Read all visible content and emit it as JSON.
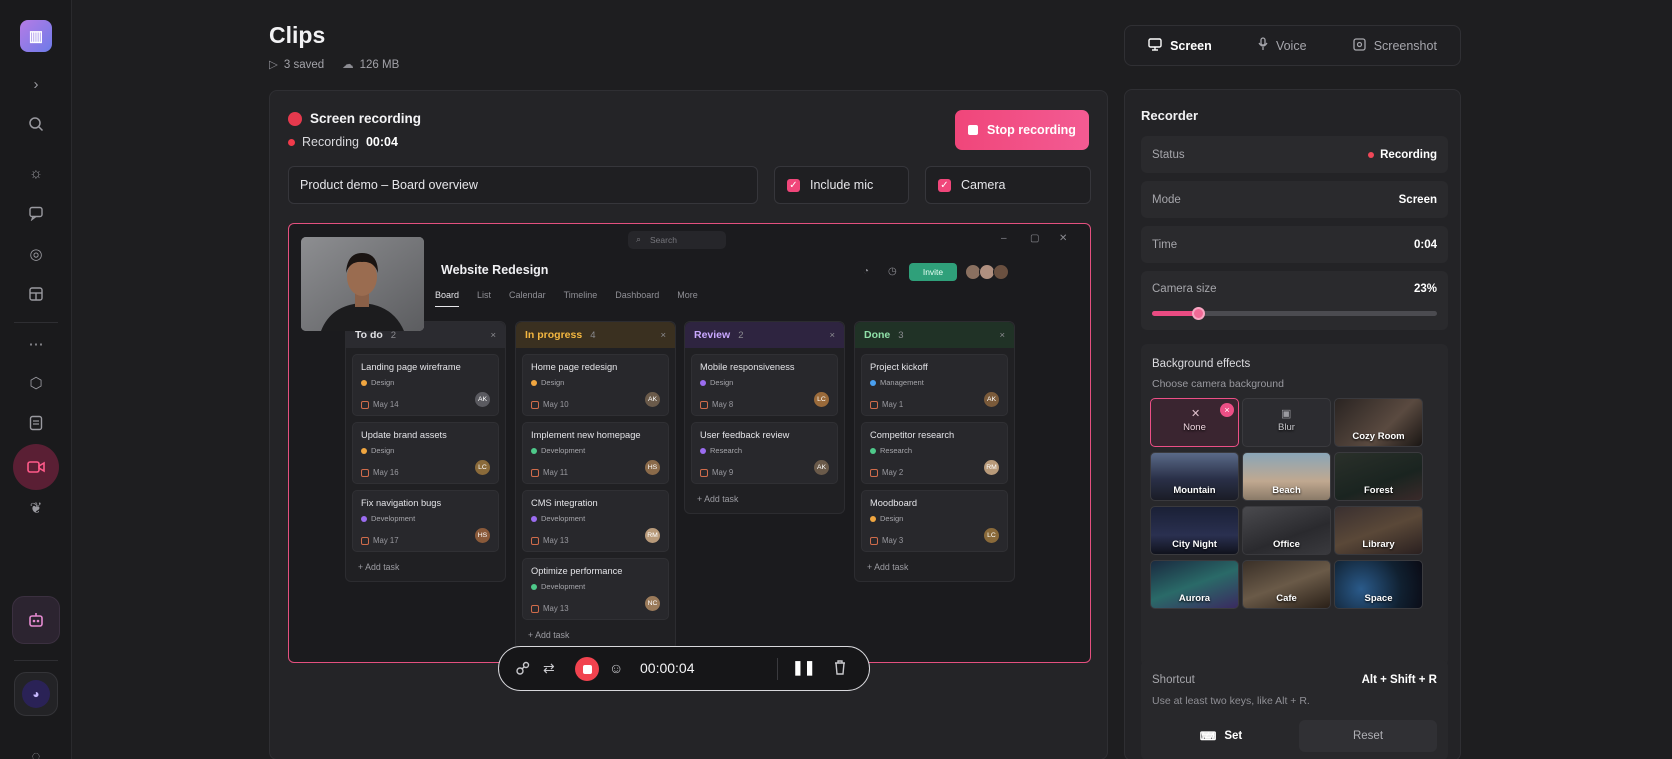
{
  "page": {
    "title": "Clips",
    "saved": "3 saved",
    "size": "126 MB"
  },
  "mode_tabs": [
    {
      "label": "Screen",
      "icon": "monitor-icon",
      "active": true
    },
    {
      "label": "Voice",
      "icon": "mic-icon",
      "active": false
    },
    {
      "label": "Screenshot",
      "icon": "screenshot-icon",
      "active": false
    }
  ],
  "recording": {
    "title": "Screen recording",
    "status_label": "Recording",
    "elapsed": "00:04",
    "stop_label": "Stop recording",
    "clip_name": "Product demo – Board overview",
    "include_mic_label": "Include mic",
    "include_mic_checked": true,
    "camera_label": "Camera",
    "camera_checked": true
  },
  "preview": {
    "search_placeholder": "Search",
    "project_title": "Website Redesign",
    "invite_label": "Invite",
    "tabs": [
      "Board",
      "List",
      "Calendar",
      "Timeline",
      "Dashboard",
      "More"
    ],
    "columns": [
      {
        "name": "To do",
        "count": "2",
        "color": "#2b2b30",
        "text_color": "#e0e0e4",
        "cards": [
          {
            "title": "Landing page wireframe",
            "tag": "Design",
            "tag_color": "#f0a640",
            "date": "May 14",
            "initials": "AK",
            "avatar": "#5a5a60"
          },
          {
            "title": "Update brand assets",
            "tag": "Design",
            "tag_color": "#f0a640",
            "date": "May 16",
            "initials": "LC",
            "avatar": "#8a6a3a"
          },
          {
            "title": "Fix navigation bugs",
            "tag": "Development",
            "tag_color": "#9b6cf0",
            "date": "May 17",
            "initials": "HS",
            "avatar": "#8a5a3a"
          }
        ],
        "add": "Add task"
      },
      {
        "name": "In progress",
        "count": "4",
        "color": "#3a3020",
        "text_color": "#f4b740",
        "cards": [
          {
            "title": "Home page redesign",
            "tag": "Design",
            "tag_color": "#f0a640",
            "date": "May 10",
            "initials": "AK",
            "avatar": "#6a5a4a"
          },
          {
            "title": "Implement new homepage",
            "tag": "Development",
            "tag_color": "#4ec98a",
            "date": "May 11",
            "initials": "HS",
            "avatar": "#8a6a4a"
          },
          {
            "title": "CMS integration",
            "tag": "Development",
            "tag_color": "#9b6cf0",
            "date": "May 13",
            "initials": "RM",
            "avatar": "#b89a7a"
          },
          {
            "title": "Optimize performance",
            "tag": "Development",
            "tag_color": "#4ec98a",
            "date": "May 13",
            "initials": "NC",
            "avatar": "#9a7a5a"
          }
        ],
        "add": "Add task"
      },
      {
        "name": "Review",
        "count": "2",
        "color": "#2e2440",
        "text_color": "#c9a8ff",
        "cards": [
          {
            "title": "Mobile responsiveness",
            "tag": "Design",
            "tag_color": "#9b6cf0",
            "date": "May 8",
            "initials": "LC",
            "avatar": "#9a6a3a"
          },
          {
            "title": "User feedback review",
            "tag": "Research",
            "tag_color": "#9b6cf0",
            "date": "May 9",
            "initials": "AK",
            "avatar": "#6a5a4a"
          }
        ],
        "add": "Add task"
      },
      {
        "name": "Done",
        "count": "3",
        "color": "#203226",
        "text_color": "#8fe0a8",
        "cards": [
          {
            "title": "Project kickoff",
            "tag": "Management",
            "tag_color": "#4aa0f0",
            "date": "May 1",
            "initials": "AK",
            "avatar": "#7a5a3a"
          },
          {
            "title": "Competitor research",
            "tag": "Research",
            "tag_color": "#4ec98a",
            "date": "May 2",
            "initials": "RM",
            "avatar": "#b89a7a"
          },
          {
            "title": "Moodboard",
            "tag": "Design",
            "tag_color": "#f0a640",
            "date": "May 3",
            "initials": "LC",
            "avatar": "#8a6a3a"
          }
        ],
        "add": "Add task"
      }
    ]
  },
  "toolbar": {
    "timer": "00:00:04"
  },
  "recorder": {
    "heading": "Recorder",
    "status_label": "Status",
    "status_value": "Recording",
    "mode_label": "Mode",
    "mode_value": "Screen",
    "time_label": "Time",
    "time_value": "0:04",
    "camera_size_label": "Camera size",
    "camera_size_value": "23%",
    "camera_size_fraction": 0.16,
    "bg_title": "Background effects",
    "bg_subtitle": "Choose camera background",
    "backgrounds": [
      {
        "label": "None",
        "selected": true,
        "fill": "#3a2530"
      },
      {
        "label": "Blur",
        "selected": false,
        "fill": "#2c2c30"
      },
      {
        "label": "Cozy Room",
        "selected": false,
        "fill": "linear-gradient(135deg,#2a2422,#5a4a40 60%,#1a1614)"
      },
      {
        "label": "Mountain",
        "selected": false,
        "fill": "linear-gradient(180deg,#5a6a88,#2a3048 55%,#1a1c26)"
      },
      {
        "label": "Beach",
        "selected": false,
        "fill": "linear-gradient(180deg,#8aa6b8,#c0a890 60%,#8a7a68)"
      },
      {
        "label": "Forest",
        "selected": false,
        "fill": "linear-gradient(160deg,#2a302a,#1a2420 60%,#3a2a2a)"
      },
      {
        "label": "City Night",
        "selected": false,
        "fill": "linear-gradient(180deg,#1a2036,#2a3050 60%,#10121c)"
      },
      {
        "label": "Office",
        "selected": false,
        "fill": "linear-gradient(160deg,#4a4a4e,#2a2a2e 60%,#3a3a3e)"
      },
      {
        "label": "Library",
        "selected": false,
        "fill": "linear-gradient(160deg,#3a3030,#5a4838 50%,#2a2020)"
      },
      {
        "label": "Aurora",
        "selected": false,
        "fill": "linear-gradient(160deg,#1a2a40,#2a6a68 50%,#3a2a60)"
      },
      {
        "label": "Cafe",
        "selected": false,
        "fill": "linear-gradient(160deg,#3a3028,#6a5a48 50%,#2a2018)"
      },
      {
        "label": "Space",
        "selected": false,
        "fill": "radial-gradient(circle at 30% 60%,#2a5a8a,#102030 60%,#0a0a14)"
      }
    ],
    "shortcut_label": "Shortcut",
    "shortcut_value": "Alt + Shift + R",
    "shortcut_hint": "Use at least two keys, like Alt + R.",
    "set_label": "Set",
    "reset_label": "Reset"
  }
}
